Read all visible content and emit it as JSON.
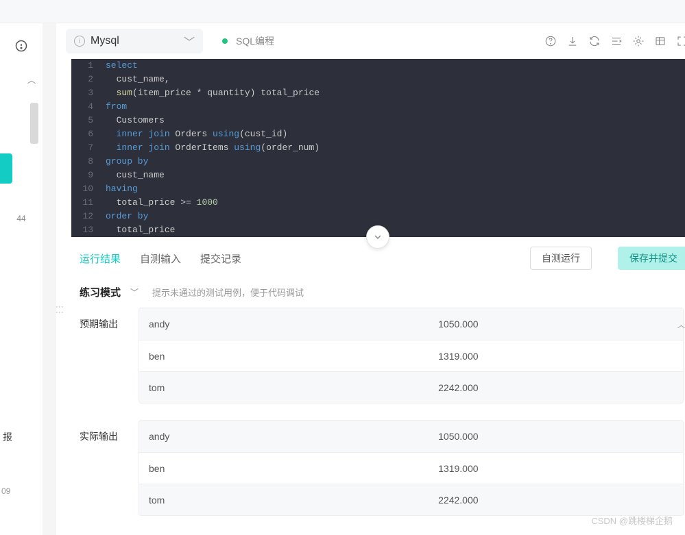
{
  "toolbar": {
    "db_name": "Mysql",
    "status_text": "SQL编程",
    "icons": [
      "help-icon",
      "download-icon",
      "refresh-icon",
      "format-icon",
      "settings-icon",
      "table-icon",
      "fullscreen-icon"
    ]
  },
  "editor": {
    "lines": [
      {
        "n": 1,
        "tokens": [
          [
            "kw",
            "select"
          ]
        ]
      },
      {
        "n": 2,
        "tokens": [
          [
            "guide",
            "  "
          ],
          [
            "id",
            "cust_name,"
          ]
        ]
      },
      {
        "n": 3,
        "tokens": [
          [
            "guide",
            "  "
          ],
          [
            "fn",
            "sum"
          ],
          [
            "id",
            "(item_price * quantity) total_price"
          ]
        ]
      },
      {
        "n": 4,
        "tokens": [
          [
            "kw",
            "from"
          ]
        ]
      },
      {
        "n": 5,
        "tokens": [
          [
            "guide",
            "  "
          ],
          [
            "id",
            "Customers"
          ]
        ]
      },
      {
        "n": 6,
        "tokens": [
          [
            "guide",
            "  "
          ],
          [
            "kw",
            "inner join"
          ],
          [
            "id",
            " Orders "
          ],
          [
            "kw",
            "using"
          ],
          [
            "id",
            "(cust_id)"
          ]
        ]
      },
      {
        "n": 7,
        "tokens": [
          [
            "guide",
            "  "
          ],
          [
            "kw",
            "inner join"
          ],
          [
            "id",
            " OrderItems "
          ],
          [
            "kw",
            "using"
          ],
          [
            "id",
            "(order_num)"
          ]
        ]
      },
      {
        "n": 8,
        "tokens": [
          [
            "kw",
            "group by"
          ]
        ]
      },
      {
        "n": 9,
        "tokens": [
          [
            "guide",
            "  "
          ],
          [
            "id",
            "cust_name"
          ]
        ]
      },
      {
        "n": 10,
        "tokens": [
          [
            "kw",
            "having"
          ]
        ]
      },
      {
        "n": 11,
        "tokens": [
          [
            "guide",
            "  "
          ],
          [
            "id",
            "total_price >= "
          ],
          [
            "num",
            "1000"
          ]
        ]
      },
      {
        "n": 12,
        "tokens": [
          [
            "kw",
            "order by"
          ]
        ]
      },
      {
        "n": 13,
        "tokens": [
          [
            "guide",
            "  "
          ],
          [
            "id",
            "total_price"
          ]
        ]
      }
    ]
  },
  "tabs": {
    "items": [
      "运行结果",
      "自测输入",
      "提交记录"
    ],
    "active": 0,
    "self_test_btn": "自测运行",
    "submit_btn": "保存并提交"
  },
  "mode": {
    "label": "练习模式",
    "hint": "提示未通过的测试用例，便于代码调试"
  },
  "results": {
    "expected_label": "预期输出",
    "actual_label": "实际输出",
    "expected": [
      {
        "name": "andy",
        "value": "1050.000"
      },
      {
        "name": "ben",
        "value": "1319.000"
      },
      {
        "name": "tom",
        "value": "2242.000"
      }
    ],
    "actual": [
      {
        "name": "andy",
        "value": "1050.000"
      },
      {
        "name": "ben",
        "value": "1319.000"
      },
      {
        "name": "tom",
        "value": "2242.000"
      }
    ]
  },
  "left": {
    "badge": "44",
    "bao": "报",
    "small": "09"
  },
  "watermark": "CSDN @跳楼梯企鹅"
}
